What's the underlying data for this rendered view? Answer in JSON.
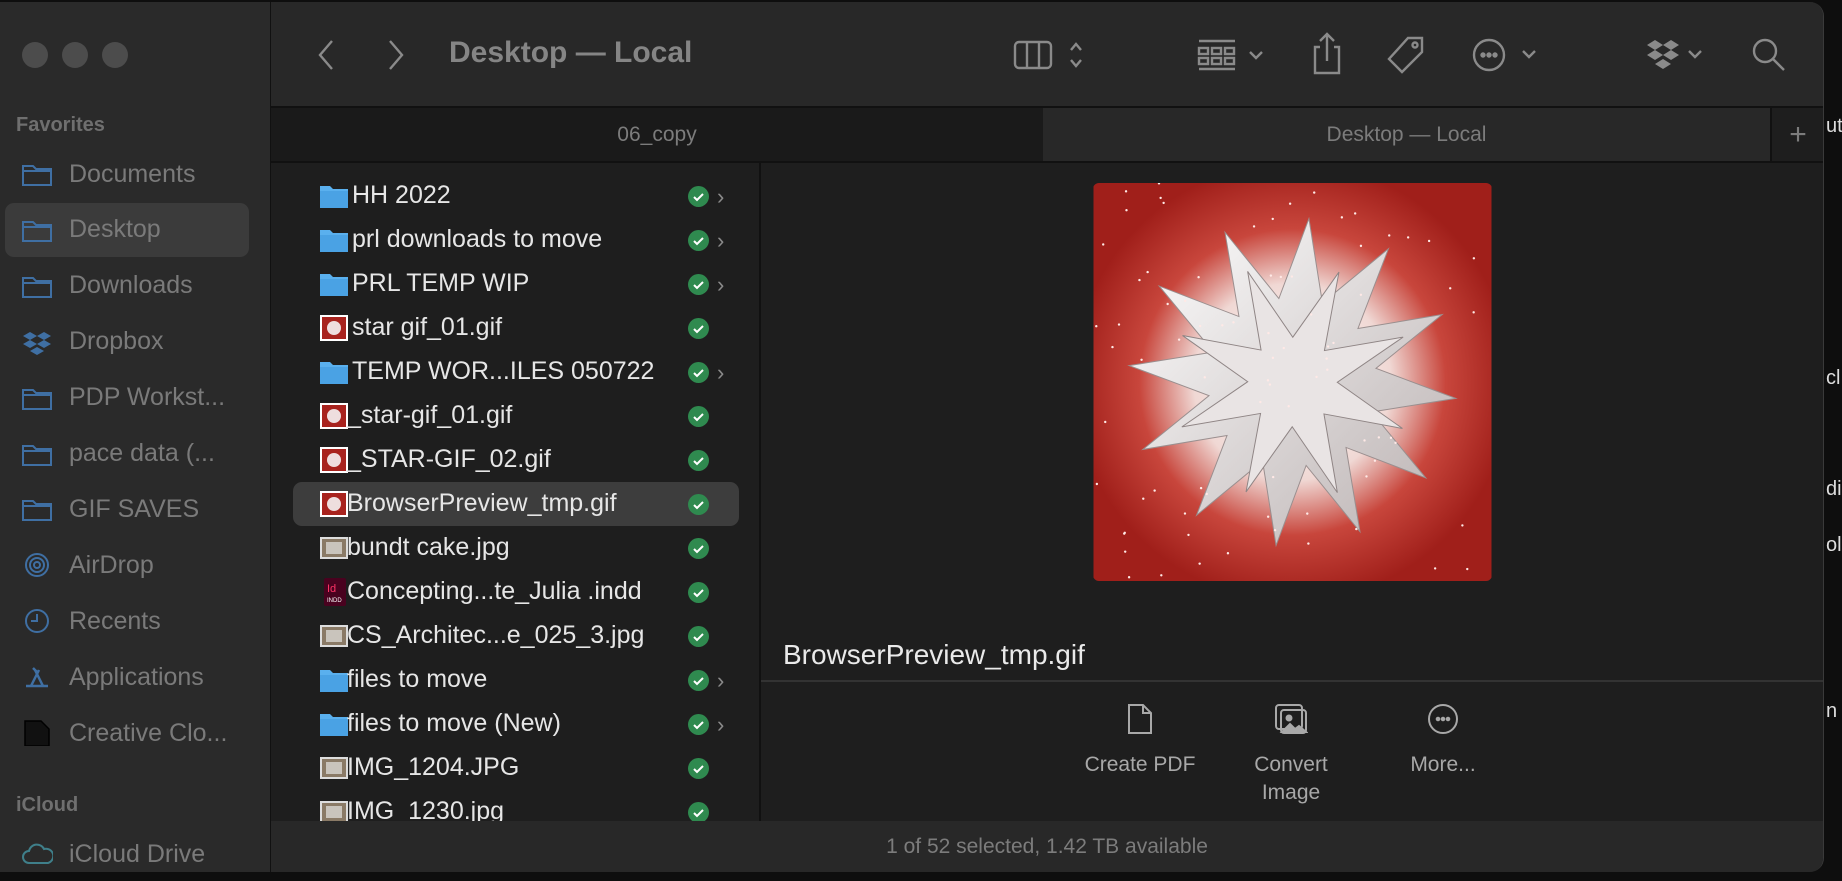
{
  "window": {
    "title": "Desktop — Local"
  },
  "toolbar": {
    "icons": [
      "back-icon",
      "forward-icon",
      "column-view-icon",
      "group-icon",
      "share-icon",
      "tag-icon",
      "more-icon",
      "dropbox-icon",
      "search-icon"
    ]
  },
  "tabs": [
    {
      "label": "06_copy",
      "active": false
    },
    {
      "label": "Desktop — Local",
      "active": true
    }
  ],
  "tab_add": "+",
  "sidebar": {
    "favorites_label": "Favorites",
    "items": [
      {
        "label": "Documents",
        "icon": "folder"
      },
      {
        "label": "Desktop",
        "icon": "folder",
        "selected": true
      },
      {
        "label": "Downloads",
        "icon": "folder"
      },
      {
        "label": "Dropbox",
        "icon": "dropbox"
      },
      {
        "label": "PDP Workst...",
        "icon": "folder"
      },
      {
        "label": " pace data (...",
        "icon": "folder"
      },
      {
        "label": "GIF SAVES",
        "icon": "folder"
      },
      {
        "label": "AirDrop",
        "icon": "airdrop"
      },
      {
        "label": "Recents",
        "icon": "clock"
      },
      {
        "label": "Applications",
        "icon": "apps"
      },
      {
        "label": "Creative Clo...",
        "icon": "doc"
      }
    ],
    "icloud_label": "iCloud",
    "icloud_items": [
      {
        "label": "iCloud Drive",
        "icon": "cloud"
      }
    ]
  },
  "files": [
    {
      "name": "HH 2022",
      "type": "folder",
      "synced": true
    },
    {
      "name": "prl downloads to move",
      "type": "folder",
      "synced": true
    },
    {
      "name": "PRL TEMP WIP",
      "type": "folder",
      "synced": true
    },
    {
      "name": "star gif_01.gif",
      "type": "gif",
      "synced": true
    },
    {
      "name": "TEMP WOR...ILES 050722",
      "type": "folder",
      "synced": true
    },
    {
      "name": "_star-gif_01.gif",
      "type": "gif",
      "synced": true
    },
    {
      "name": "_STAR-GIF_02.gif",
      "type": "gif",
      "synced": true
    },
    {
      "name": "BrowserPreview_tmp.gif",
      "type": "gif",
      "synced": true,
      "selected": true
    },
    {
      "name": "bundt cake.jpg",
      "type": "jpg",
      "synced": true
    },
    {
      "name": "Concepting...te_Julia .indd",
      "type": "indd",
      "synced": true
    },
    {
      "name": "CS_Architec...e_025_3.jpg",
      "type": "jpg",
      "synced": true
    },
    {
      "name": "files to move",
      "type": "folder",
      "synced": true
    },
    {
      "name": "files to move (New)",
      "type": "folder",
      "synced": true
    },
    {
      "name": "IMG_1204.JPG",
      "type": "jpg",
      "synced": true
    },
    {
      "name": "IMG_1230.jpg",
      "type": "jpg",
      "synced": true
    }
  ],
  "preview": {
    "filename": "BrowserPreview_tmp.gif",
    "actions": [
      {
        "label": "Create PDF",
        "icon": "document-icon"
      },
      {
        "label": "Convert\nImage",
        "icon": "photos-icon"
      },
      {
        "label": "More...",
        "icon": "ellipsis-circle-icon"
      }
    ]
  },
  "status": "1 of 52 selected, 1.42 TB available",
  "colors": {
    "sync_ok": "#2f8a4f",
    "folder": "#5ab0ee",
    "preview_bg": "#a8231e"
  },
  "background_fragments": [
    "ut",
    "cl",
    "di",
    "ol",
    "n"
  ]
}
